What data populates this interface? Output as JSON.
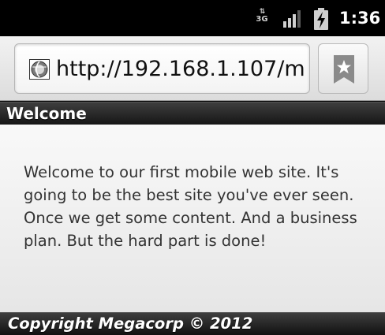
{
  "status_bar": {
    "network": "3G",
    "network_icon": "3g-data-icon",
    "signal_icon": "signal-strength-icon",
    "signal_bars_lit": 3,
    "signal_bars_total": 4,
    "battery_icon": "battery-charging-icon",
    "time": "1:36"
  },
  "browser": {
    "url": "http://192.168.1.107/m...",
    "site_icon": "globe-icon",
    "bookmark_icon": "bookmark-star-icon"
  },
  "page": {
    "title": "Welcome",
    "body": "Welcome to our first mobile web site. It's going to be the best site you've ever seen. Once we get some content. And a business plan. But the hard part is done!",
    "footer": "Copyright Megacorp © 2012"
  },
  "colors": {
    "header_bg": "#2a2a2a",
    "content_bg": "#f2f2f2",
    "text": "#333333",
    "status_bar_bg": "#000000"
  }
}
